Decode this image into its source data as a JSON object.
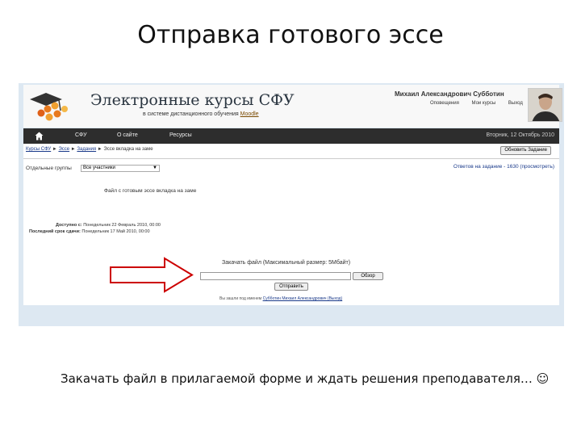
{
  "slide": {
    "title": "Отправка готового эссе",
    "caption": "Закачать файл в прилагаемой форме и ждать решения преподавателя… ☺"
  },
  "site": {
    "name": "Электронные курсы СФУ",
    "subtitle_prefix": "в системе дистанционного обучения",
    "subtitle_link": "Moodle",
    "logo_icon": "graduation-cap-molecule-icon"
  },
  "user": {
    "name": "Михаил Александрович Субботин",
    "links": [
      "Оповещения",
      "Мои курсы",
      "Выход"
    ]
  },
  "nav": {
    "home_icon": "home-icon",
    "items": [
      "СФУ",
      "О сайте",
      "Ресурсы"
    ],
    "date": "Вторник, 12 Октябрь 2010"
  },
  "page": {
    "breadcrumb": [
      "Курсы СФУ",
      "Эссе",
      "Задания",
      "Эссе вкладка на заме"
    ],
    "update_button": "Обновить Задание",
    "groups_label": "Отдельные группы",
    "groups_select": "Все участники",
    "answers_link": "Ответов на задание - 1630 (просмотреть)",
    "task_text": "Файл с готовым эссе вкладка на заме",
    "available_label": "Доступно с:",
    "available_value": "Понедельник 22 Февраль 2010, 00:00",
    "due_label": "Последний срок сдачи:",
    "due_value": "Понедельник 17 Май 2010, 00:00",
    "upload_label": "Закачать файл (Максимальный размер: 5Мбайт)",
    "browse_button": "Обзор",
    "send_button": "Отправить",
    "logged_in_prefix": "Вы зашли под именем",
    "logged_in_user": "Субботин Михаил Александрович (Выход)"
  },
  "colors": {
    "navbar": "#2d2d2d",
    "arrow": "#cc0000",
    "screenshot_bg": "#dde8f2",
    "link": "#1a3a8a"
  }
}
